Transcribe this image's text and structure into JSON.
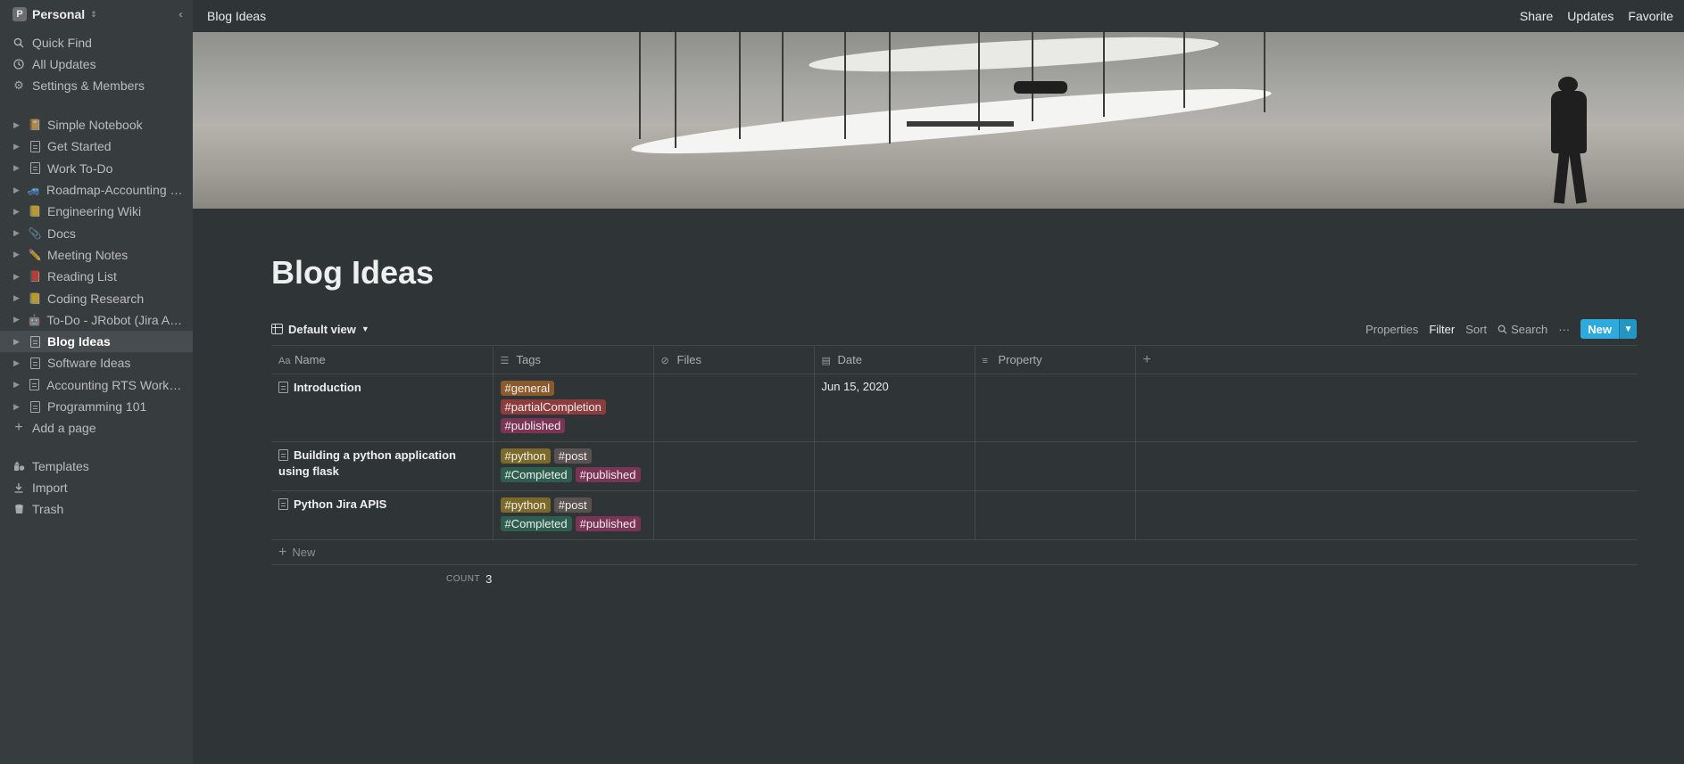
{
  "workspace": {
    "avatar_letter": "P",
    "name": "Personal"
  },
  "sidebar": {
    "nav": [
      {
        "label": "Quick Find",
        "icon": "search-icon"
      },
      {
        "label": "All Updates",
        "icon": "clock-icon"
      },
      {
        "label": "Settings & Members",
        "icon": "gear-icon"
      }
    ],
    "pages": [
      {
        "label": "Simple Notebook",
        "icon": "notebook-emoji"
      },
      {
        "label": "Get Started",
        "icon": "page-icon"
      },
      {
        "label": "Work To-Do",
        "icon": "page-icon"
      },
      {
        "label": "Roadmap-Accounting R...",
        "icon": "car-emoji"
      },
      {
        "label": "Engineering Wiki",
        "icon": "ledger-emoji"
      },
      {
        "label": "Docs",
        "icon": "paperclip-emoji"
      },
      {
        "label": "Meeting Notes",
        "icon": "pencil-emoji"
      },
      {
        "label": "Reading List",
        "icon": "book-emoji"
      },
      {
        "label": "Coding Research",
        "icon": "ledger-emoji"
      },
      {
        "label": "To-Do - JRobot (Jira Au...",
        "icon": "robot-emoji"
      },
      {
        "label": "Blog Ideas",
        "icon": "page-icon",
        "active": true
      },
      {
        "label": "Software Ideas",
        "icon": "page-icon"
      },
      {
        "label": "Accounting RTS Work T...",
        "icon": "page-icon"
      },
      {
        "label": "Programming 101",
        "icon": "page-icon"
      }
    ],
    "add_page": "Add a page",
    "bottom": [
      {
        "label": "Templates",
        "icon": "templates-icon"
      },
      {
        "label": "Import",
        "icon": "import-icon"
      },
      {
        "label": "Trash",
        "icon": "trash-icon"
      }
    ]
  },
  "topbar": {
    "breadcrumb": "Blog Ideas",
    "share": "Share",
    "updates": "Updates",
    "favorite": "Favorite"
  },
  "page": {
    "title": "Blog Ideas",
    "view_name": "Default view",
    "tools": {
      "properties": "Properties",
      "filter": "Filter",
      "sort": "Sort",
      "search": "Search",
      "more": "···",
      "new": "New"
    }
  },
  "table": {
    "columns": [
      {
        "label": "Name",
        "icon": "text-icon"
      },
      {
        "label": "Tags",
        "icon": "list-icon"
      },
      {
        "label": "Files",
        "icon": "paperclip-icon"
      },
      {
        "label": "Date",
        "icon": "calendar-icon"
      },
      {
        "label": "Property",
        "icon": "text-lines-icon"
      }
    ],
    "rows": [
      {
        "name": "Introduction",
        "tags": [
          {
            "label": "#general",
            "color": "#8a5a2d"
          },
          {
            "label": "#partialCompletion",
            "color": "#8b3d3d"
          },
          {
            "label": "#published",
            "color": "#7a3556"
          }
        ],
        "date": "Jun 15, 2020"
      },
      {
        "name": "Building a python application using flask",
        "tags": [
          {
            "label": "#python",
            "color": "#7d6a2a"
          },
          {
            "label": "#post",
            "color": "#5a5250"
          },
          {
            "label": "#Completed",
            "color": "#2f5e4e"
          },
          {
            "label": "#published",
            "color": "#7a3556"
          }
        ],
        "date": ""
      },
      {
        "name": "Python Jira APIS",
        "tags": [
          {
            "label": "#python",
            "color": "#7d6a2a"
          },
          {
            "label": "#post",
            "color": "#5a5250"
          },
          {
            "label": "#Completed",
            "color": "#2f5e4e"
          },
          {
            "label": "#published",
            "color": "#7a3556"
          }
        ],
        "date": ""
      }
    ],
    "add_new": "New",
    "count_label": "COUNT",
    "count_value": "3"
  },
  "colors": {
    "accent": "#2eaadc",
    "background": "#2f3437",
    "sidebar": "#373c3f"
  }
}
